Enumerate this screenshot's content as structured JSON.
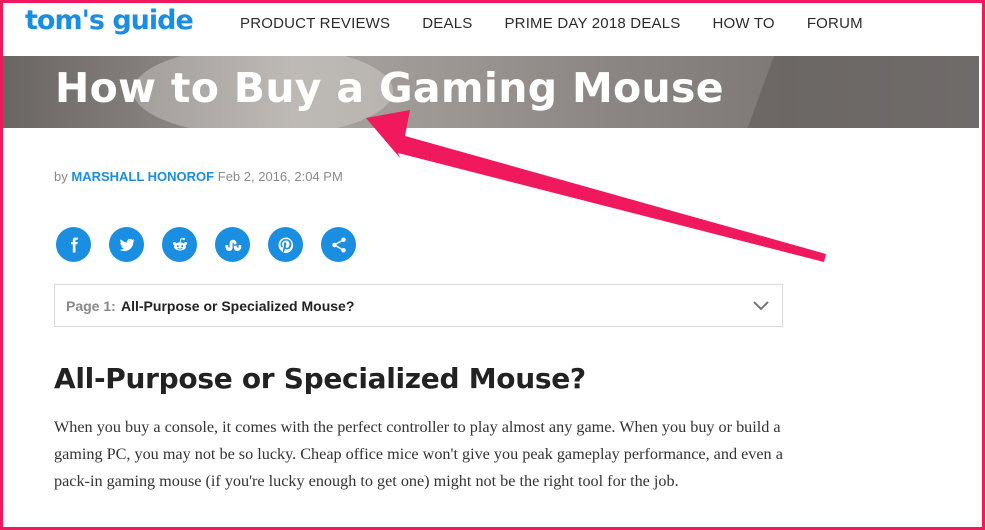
{
  "brand": {
    "logo_text": "tom's guide"
  },
  "nav": {
    "items": [
      {
        "label": "PRODUCT REVIEWS"
      },
      {
        "label": "DEALS"
      },
      {
        "label": "PRIME DAY 2018 DEALS"
      },
      {
        "label": "HOW TO"
      },
      {
        "label": "FORUM"
      }
    ]
  },
  "article": {
    "title": "How to Buy a Gaming Mouse",
    "by_prefix": "by",
    "author": "MARSHALL HONOROF",
    "date": "Feb 2, 2016, 2:04 PM",
    "share_icons": [
      "facebook-icon",
      "twitter-icon",
      "reddit-icon",
      "stumbleupon-icon",
      "pinterest-icon",
      "share-icon"
    ],
    "page_select": {
      "page_label": "Page 1:",
      "value": "All-Purpose or Specialized Mouse?"
    },
    "section_heading": "All-Purpose or Specialized Mouse?",
    "paragraph": "When you buy a console, it comes with the perfect controller to play almost any game. When you buy or build a gaming PC, you may not be so lucky. Cheap office mice won't give you peak gameplay performance, and even a pack-in gaming mouse (if you're lucky enough to get one) might not be the right tool for the job."
  },
  "colors": {
    "brand_blue": "#1a8ee0",
    "annotation_pink": "#f0195e"
  }
}
